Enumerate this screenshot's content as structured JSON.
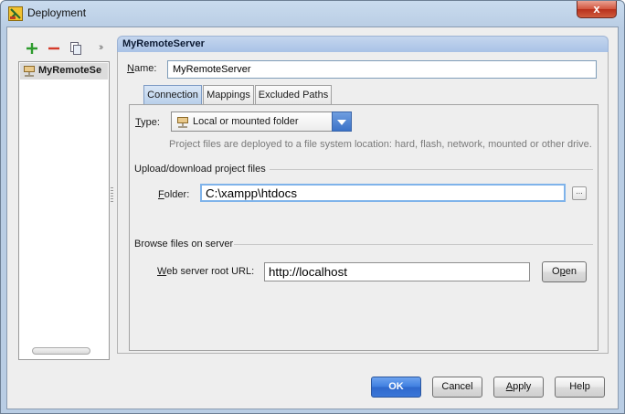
{
  "window": {
    "title": "Deployment",
    "close_glyph": "x",
    "icon": "app-logo-icon"
  },
  "toolbar": {
    "add_icon": "plus-icon",
    "remove_icon": "minus-icon",
    "copy_icon": "copy-icon",
    "more": "››"
  },
  "server_list": {
    "items": [
      {
        "label": "MyRemoteSe",
        "icon": "server-icon"
      }
    ]
  },
  "panel": {
    "header": "MyRemoteServer",
    "name_label": "Name:",
    "name_value": "MyRemoteServer",
    "tabs": [
      {
        "label": "Connection",
        "active": true
      },
      {
        "label": "Mappings",
        "active": false
      },
      {
        "label": "Excluded Paths",
        "active": false
      }
    ],
    "type_label": "Type:",
    "type_value": "Local or mounted folder",
    "type_description": "Project files are deployed to a file system location: hard, flash, network, mounted or other drive.",
    "upload_section": "Upload/download project files",
    "folder_label": "Folder:",
    "folder_value": "C:\\xampp\\htdocs",
    "browse_glyph": "...",
    "browse_section": "Browse files on server",
    "url_label": "Web server root URL:",
    "url_value": "http://localhost",
    "open_label": "Open"
  },
  "buttons": {
    "ok": "OK",
    "cancel": "Cancel",
    "apply": "Apply",
    "help": "Help"
  },
  "colors": {
    "add": "#2e9b2e",
    "remove": "#d43a2a",
    "accent": "#3f7ee0"
  }
}
